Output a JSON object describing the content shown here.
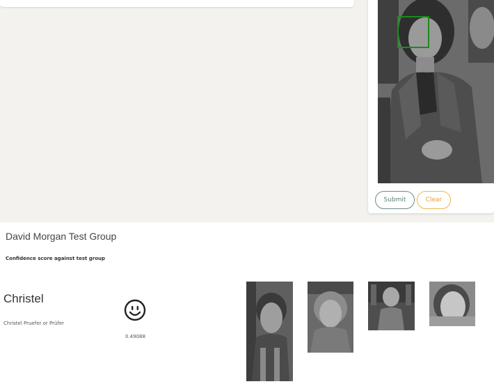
{
  "photo_panel": {
    "submit_label": "Submit",
    "clear_label": "Clear"
  },
  "results": {
    "group_title": "David Morgan Test Group",
    "subtitle": "Confidence score against test group",
    "match": {
      "name": "Christel",
      "aka": "Christel Pruefer or Prüfer",
      "score": "0.49088",
      "icon": "smiley-face-icon"
    }
  },
  "colors": {
    "submit_border": "#6c8a86",
    "clear_border": "#f0b34d",
    "face_box": "#1c8a1c",
    "background": "#f3f2ee"
  }
}
